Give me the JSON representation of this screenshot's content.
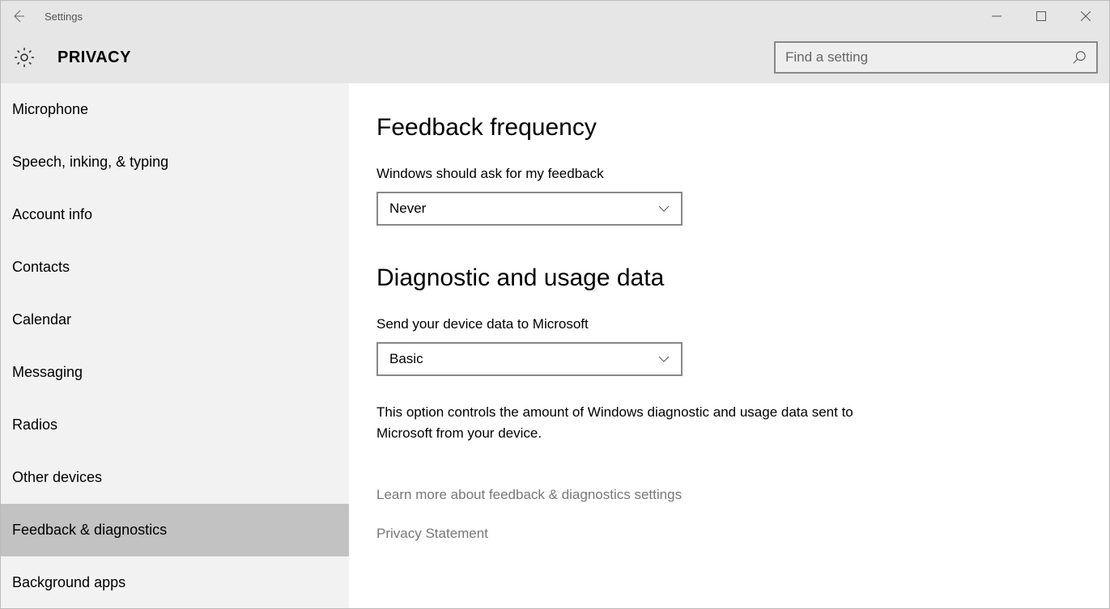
{
  "window": {
    "title": "Settings"
  },
  "header": {
    "page_title": "PRIVACY",
    "search_placeholder": "Find a setting"
  },
  "sidebar": {
    "items": [
      {
        "label": "Microphone"
      },
      {
        "label": "Speech, inking, & typing"
      },
      {
        "label": "Account info"
      },
      {
        "label": "Contacts"
      },
      {
        "label": "Calendar"
      },
      {
        "label": "Messaging"
      },
      {
        "label": "Radios"
      },
      {
        "label": "Other devices"
      },
      {
        "label": "Feedback & diagnostics",
        "active": true
      },
      {
        "label": "Background apps"
      }
    ]
  },
  "main": {
    "section1_title": "Feedback frequency",
    "feedback_label": "Windows should ask for my feedback",
    "feedback_value": "Never",
    "section2_title": "Diagnostic and usage data",
    "diag_label": "Send your device data to Microsoft",
    "diag_value": "Basic",
    "diag_desc": "This option controls the amount of Windows diagnostic and usage data sent to Microsoft from your device.",
    "link_learn_more": "Learn more about feedback & diagnostics settings",
    "link_privacy": "Privacy Statement"
  }
}
